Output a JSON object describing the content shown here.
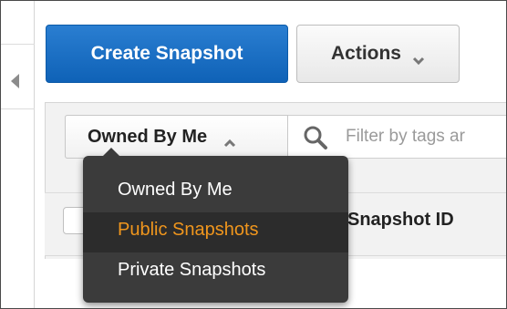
{
  "toolbar": {
    "create_label": "Create Snapshot",
    "actions_label": "Actions",
    "actions_caret_icon": "chevron-down-icon"
  },
  "filter": {
    "selected": "Owned By Me",
    "caret_icon": "chevron-up-icon",
    "search_icon": "search-icon",
    "search_placeholder": "Filter by tags and attributes or search by keyword",
    "visible_placeholder": "Filter by tags ar"
  },
  "table": {
    "columns": [
      "Snapshot ID"
    ],
    "visible_header": "Snapshot ID"
  },
  "dropdown": {
    "items": [
      {
        "label": "Owned By Me",
        "active": false
      },
      {
        "label": "Public Snapshots",
        "active": true
      },
      {
        "label": "Private Snapshots",
        "active": false
      }
    ]
  },
  "colors": {
    "primary": "#1a6fc8",
    "menu_bg": "#3b3b3b",
    "menu_highlight": "#f0961d"
  }
}
